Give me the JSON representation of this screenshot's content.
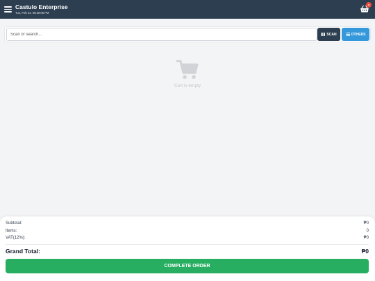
{
  "header": {
    "store_name": "Castulo Enterprise",
    "date": "Tue, Feb 24, 05:30:05 PM",
    "cart_count": "0"
  },
  "search": {
    "placeholder": "Scan or search...",
    "scan_label": "SCAN",
    "others_label": "OTHERS"
  },
  "cart": {
    "empty_text": "Cart is empty"
  },
  "summary": {
    "subtotal_label": "Subtotal:",
    "subtotal_value": "₱0",
    "items_label": "Items:",
    "items_value": "0",
    "vat_label": "VAT(12%):",
    "vat_value": "₱0",
    "grand_label": "Grand Total:",
    "grand_value": "₱0",
    "complete_label": "COMPLETE ORDER"
  },
  "icons": {
    "menu": "hamburger-icon",
    "cart": "shopping-basket-icon",
    "scan": "barcode-icon",
    "others": "list-icon",
    "empty_cart": "shopping-cart-icon"
  },
  "colors": {
    "header_bg": "#2c3e50",
    "scan_bg": "#2c3e50",
    "others_bg": "#3498db",
    "complete_bg": "#27ae60",
    "badge_bg": "#e74c3c"
  }
}
